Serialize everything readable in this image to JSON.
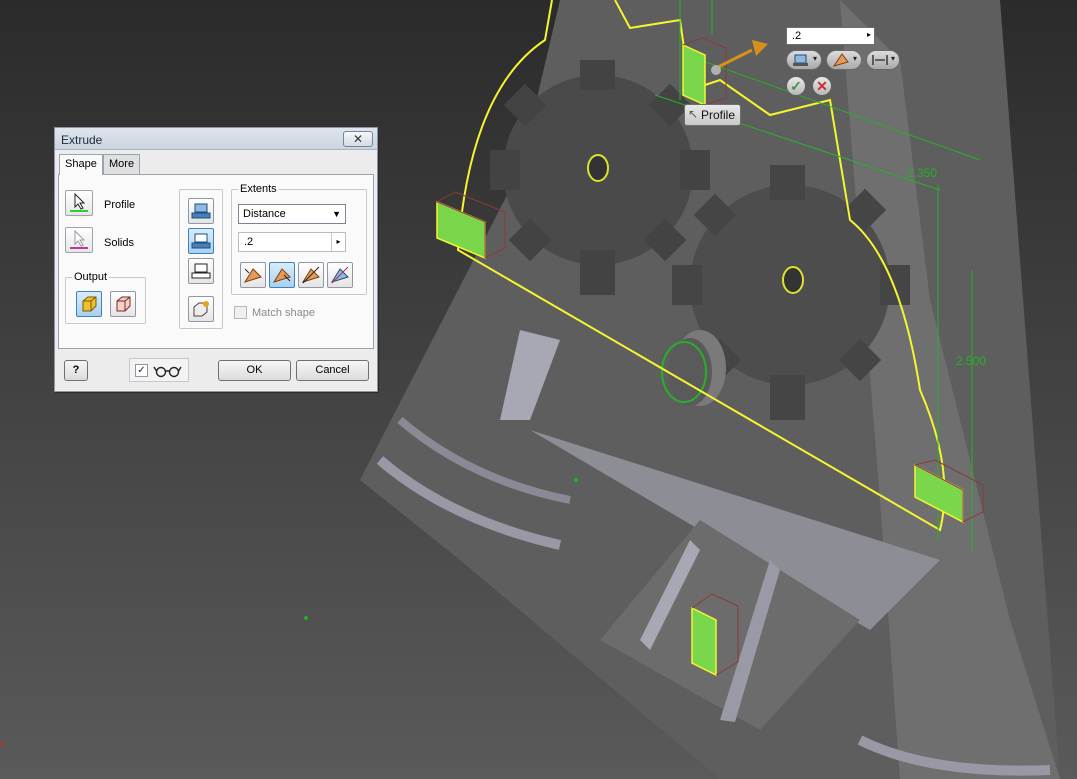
{
  "dialog": {
    "title": "Extrude",
    "close_icon": "close-x-icon",
    "tabs": [
      {
        "label": "Shape"
      },
      {
        "label": "More"
      }
    ],
    "profile_label": "Profile",
    "solids_label": "Solids",
    "output_title": "Output",
    "extents_title": "Extents",
    "extents_type": "Distance",
    "distance_value": ".2",
    "match_shape_label": "Match shape",
    "ok_label": "OK",
    "cancel_label": "Cancel",
    "preview_checked": true,
    "help_icon": "help-icon"
  },
  "minitoolbar": {
    "distance_value": ".2",
    "ok_icon": "check-icon",
    "cancel_icon": "cancel-icon"
  },
  "tooltip": {
    "label": "Profile"
  },
  "dimensions": {
    "d1": "2.350",
    "d2": "2.500"
  },
  "colors": {
    "profile_highlight": "#f5f530",
    "dimension": "#27b027",
    "face_selected": "#7ad64a",
    "model_gray": "#6a6a6a"
  }
}
